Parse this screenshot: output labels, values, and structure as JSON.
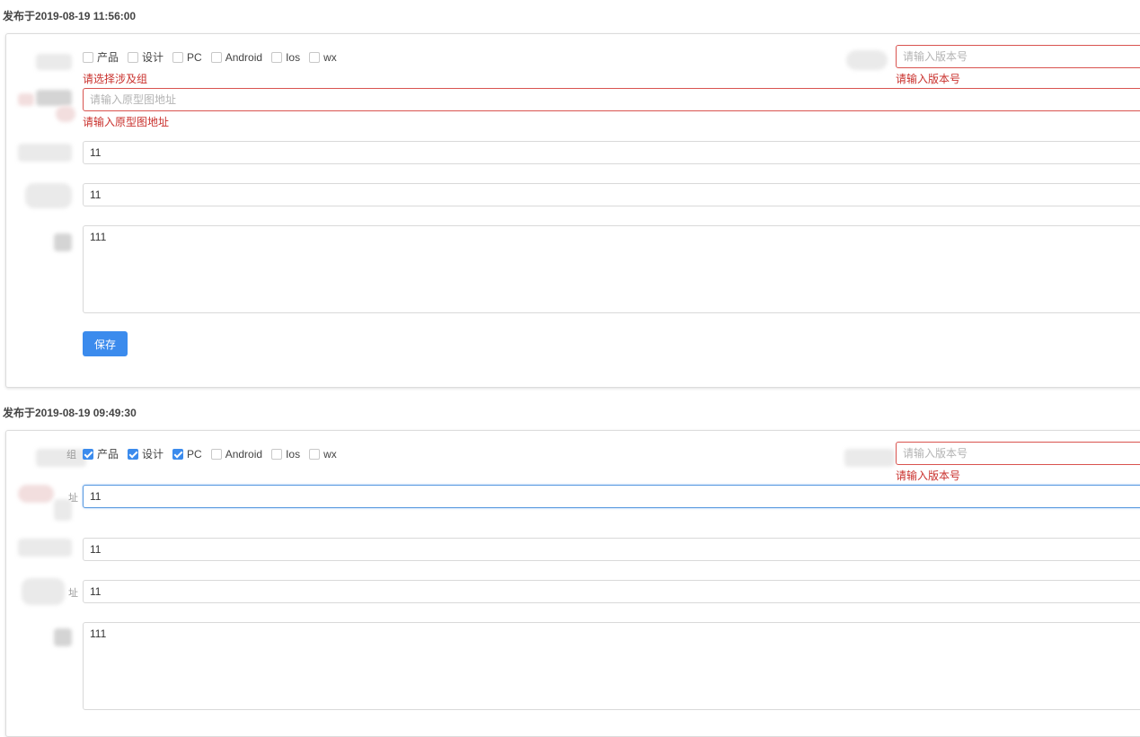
{
  "posts": [
    {
      "published_label": "发布于2019-08-19 11:56:00",
      "groups": [
        {
          "label": "产品",
          "checked": false
        },
        {
          "label": "设计",
          "checked": false
        },
        {
          "label": "PC",
          "checked": false
        },
        {
          "label": "Android",
          "checked": false
        },
        {
          "label": "Ios",
          "checked": false
        },
        {
          "label": "wx",
          "checked": false
        }
      ],
      "groups_error": "请选择涉及组",
      "version_placeholder": "请输入版本号",
      "version_value": "",
      "version_error": "请输入版本号",
      "prototype_placeholder": "请输入原型图地址",
      "prototype_value": "",
      "prototype_error": "请输入原型图地址",
      "field_a": "11",
      "field_b": "11",
      "description": "111",
      "save_label": "保存"
    },
    {
      "published_label": "发布于2019-08-19 09:49:30",
      "groups": [
        {
          "label": "产品",
          "checked": true
        },
        {
          "label": "设计",
          "checked": true
        },
        {
          "label": "PC",
          "checked": true
        },
        {
          "label": "Android",
          "checked": false
        },
        {
          "label": "Ios",
          "checked": false
        },
        {
          "label": "wx",
          "checked": false
        }
      ],
      "version_placeholder": "请输入版本号",
      "version_value": "",
      "version_error": "请输入版本号",
      "prototype_value": "11",
      "field_a": "11",
      "field_b": "11",
      "description": "111",
      "label_fragments": [
        "组",
        "址",
        "址"
      ]
    }
  ],
  "colors": {
    "accent": "#3b8bed",
    "error": "#c9302c",
    "border": "#d9d9d9"
  }
}
